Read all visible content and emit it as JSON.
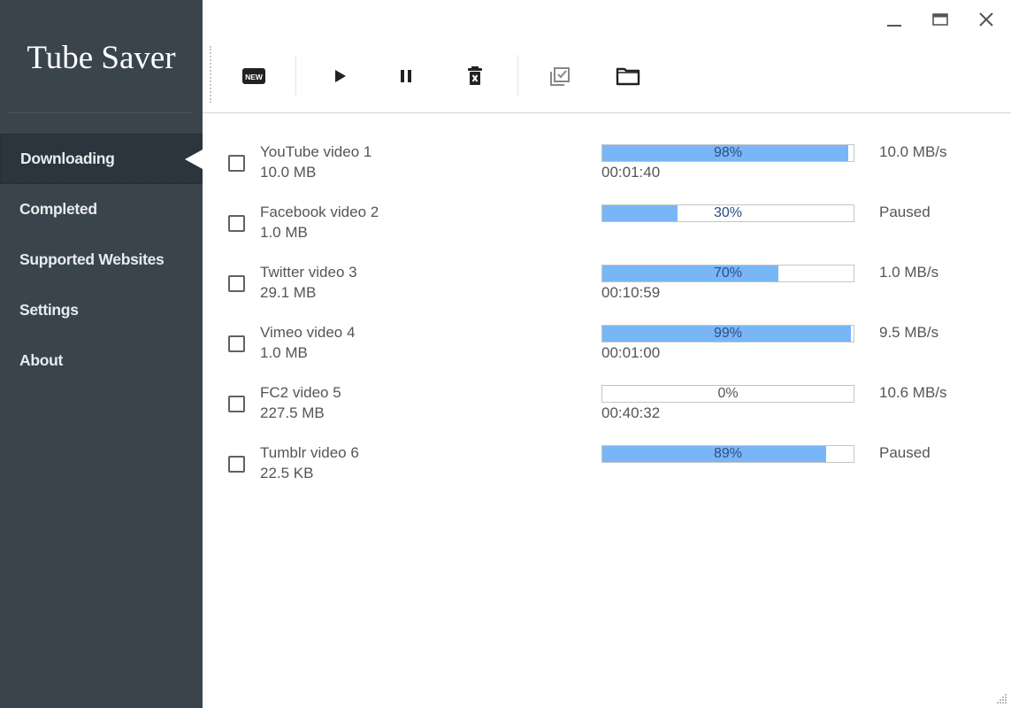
{
  "app": {
    "title": "Tube Saver"
  },
  "sidebar": {
    "items": [
      {
        "label": "Downloading",
        "active": true
      },
      {
        "label": "Completed",
        "active": false
      },
      {
        "label": "Supported Websites",
        "active": false
      },
      {
        "label": "Settings",
        "active": false
      },
      {
        "label": "About",
        "active": false
      }
    ]
  },
  "window_controls": {
    "minimize": "minimize-icon",
    "maximize": "maximize-icon",
    "close": "close-icon"
  },
  "toolbar": {
    "new_badge": "NEW",
    "buttons": [
      "new-download",
      "play",
      "pause",
      "delete",
      "select-all",
      "open-folder"
    ]
  },
  "colors": {
    "sidebar_bg": "#3a444d",
    "sidebar_active_bg": "#2c353d",
    "progress_fill": "#79b6f8",
    "progress_text": "#2c4f80",
    "text": "#555555"
  },
  "downloads": [
    {
      "title": "YouTube video 1",
      "size": "10.0 MB",
      "progress": 98,
      "progress_label": "98%",
      "eta": "00:01:40",
      "status": "10.0 MB/s"
    },
    {
      "title": "Facebook video 2",
      "size": "1.0 MB",
      "progress": 30,
      "progress_label": "30%",
      "eta": "",
      "status": "Paused"
    },
    {
      "title": "Twitter video 3",
      "size": "29.1 MB",
      "progress": 70,
      "progress_label": "70%",
      "eta": "00:10:59",
      "status": "1.0 MB/s"
    },
    {
      "title": "Vimeo video 4",
      "size": "1.0 MB",
      "progress": 99,
      "progress_label": "99%",
      "eta": "00:01:00",
      "status": "9.5 MB/s"
    },
    {
      "title": "FC2 video 5",
      "size": "227.5 MB",
      "progress": 0,
      "progress_label": "0%",
      "eta": "00:40:32",
      "status": "10.6 MB/s"
    },
    {
      "title": "Tumblr video 6",
      "size": "22.5 KB",
      "progress": 89,
      "progress_label": "89%",
      "eta": "",
      "status": "Paused"
    }
  ]
}
